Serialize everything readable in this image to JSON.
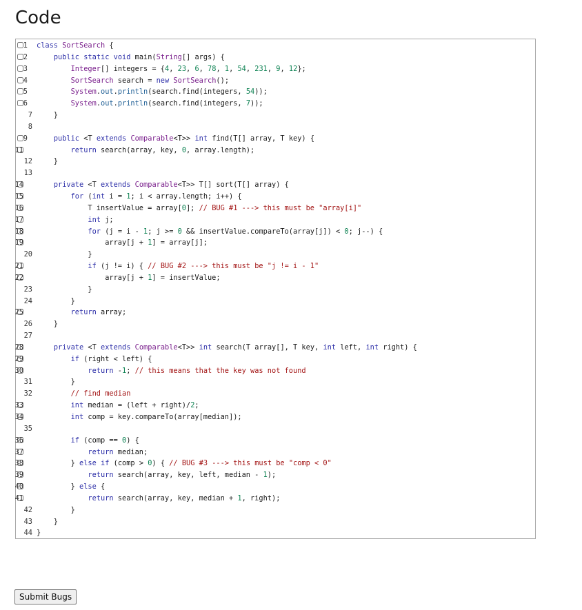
{
  "page": {
    "title": "Code"
  },
  "code_lines": [
    {
      "n": "1",
      "cb": true,
      "t": "class SortSearch {"
    },
    {
      "n": "2",
      "cb": true,
      "t": "    public static void main(String[] args) {"
    },
    {
      "n": "3",
      "cb": true,
      "t": "        Integer[] integers = {4, 23, 6, 78, 1, 54, 231, 9, 12};"
    },
    {
      "n": "4",
      "cb": true,
      "t": "        SortSearch search = new SortSearch();"
    },
    {
      "n": "5",
      "cb": true,
      "t": "        System.out.println(search.find(integers, 54));"
    },
    {
      "n": "6",
      "cb": true,
      "t": "        System.out.println(search.find(integers, 7));"
    },
    {
      "n": "7",
      "cb": false,
      "t": "    }"
    },
    {
      "n": "8",
      "cb": false,
      "t": ""
    },
    {
      "n": "9",
      "cb": true,
      "t": "    public <T extends Comparable<T>> int find(T[] array, T key) {"
    },
    {
      "n": "11",
      "cb": true,
      "t": "        return search(array, key, 0, array.length);"
    },
    {
      "n": "12",
      "cb": false,
      "t": "    }"
    },
    {
      "n": "13",
      "cb": false,
      "t": ""
    },
    {
      "n": "14",
      "cb": true,
      "t": "    private <T extends Comparable<T>> T[] sort(T[] array) {"
    },
    {
      "n": "15",
      "cb": true,
      "t": "        for (int i = 1; i < array.length; i++) {"
    },
    {
      "n": "16",
      "cb": true,
      "t": "            T insertValue = array[0]; // BUG #1 ---> this must be \"array[i]\""
    },
    {
      "n": "17",
      "cb": true,
      "t": "            int j;"
    },
    {
      "n": "18",
      "cb": true,
      "t": "            for (j = i - 1; j >= 0 && insertValue.compareTo(array[j]) < 0; j--) {"
    },
    {
      "n": "19",
      "cb": true,
      "t": "                array[j + 1] = array[j];"
    },
    {
      "n": "20",
      "cb": false,
      "t": "            }"
    },
    {
      "n": "21",
      "cb": true,
      "t": "            if (j != i) { // BUG #2 ---> this must be \"j != i - 1\""
    },
    {
      "n": "22",
      "cb": true,
      "t": "                array[j + 1] = insertValue;"
    },
    {
      "n": "23",
      "cb": false,
      "t": "            }"
    },
    {
      "n": "24",
      "cb": false,
      "t": "        }"
    },
    {
      "n": "25",
      "cb": true,
      "t": "        return array;"
    },
    {
      "n": "26",
      "cb": false,
      "t": "    }"
    },
    {
      "n": "27",
      "cb": false,
      "t": ""
    },
    {
      "n": "28",
      "cb": true,
      "t": "    private <T extends Comparable<T>> int search(T array[], T key, int left, int right) {"
    },
    {
      "n": "29",
      "cb": true,
      "t": "        if (right < left) {"
    },
    {
      "n": "30",
      "cb": true,
      "t": "            return -1; // this means that the key was not found"
    },
    {
      "n": "31",
      "cb": false,
      "t": "        }"
    },
    {
      "n": "32",
      "cb": false,
      "t": "        // find median"
    },
    {
      "n": "33",
      "cb": true,
      "t": "        int median = (left + right)/2;"
    },
    {
      "n": "34",
      "cb": true,
      "t": "        int comp = key.compareTo(array[median]);"
    },
    {
      "n": "35",
      "cb": false,
      "t": ""
    },
    {
      "n": "36",
      "cb": true,
      "t": "        if (comp == 0) {"
    },
    {
      "n": "37",
      "cb": true,
      "t": "            return median;"
    },
    {
      "n": "38",
      "cb": true,
      "t": "        } else if (comp > 0) { // BUG #3 ---> this must be \"comp < 0\""
    },
    {
      "n": "39",
      "cb": true,
      "t": "            return search(array, key, left, median - 1);"
    },
    {
      "n": "40",
      "cb": true,
      "t": "        } else {"
    },
    {
      "n": "41",
      "cb": true,
      "t": "            return search(array, key, median + 1, right);"
    },
    {
      "n": "42",
      "cb": false,
      "t": "        }"
    },
    {
      "n": "43",
      "cb": false,
      "t": "    }"
    },
    {
      "n": "44",
      "cb": false,
      "t": "}"
    }
  ],
  "actions": {
    "submit_label": "Submit Bugs"
  }
}
